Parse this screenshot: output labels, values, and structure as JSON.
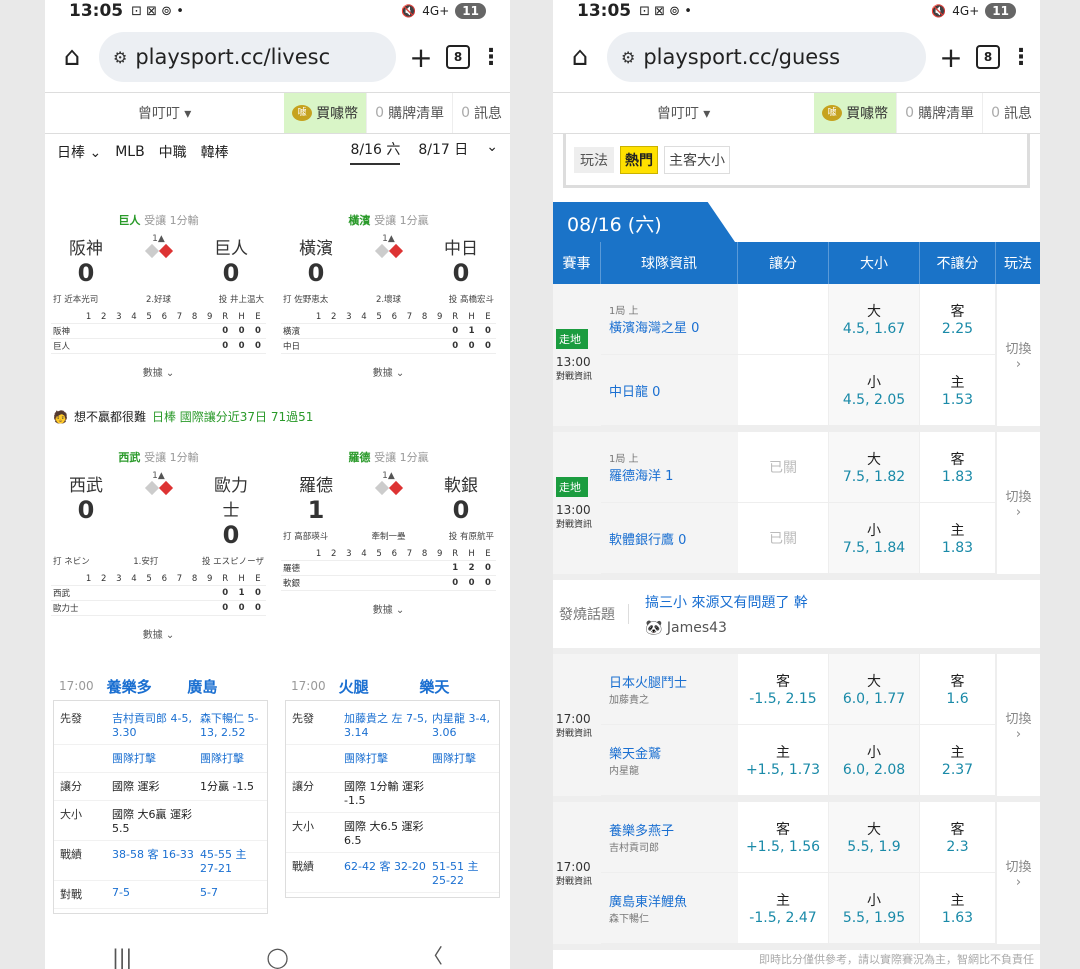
{
  "left": {
    "time": "13:05",
    "status_icons": "⊡ ⊠ ⊚ •",
    "signal": "4G+",
    "battery": "11",
    "url": "playsport.cc/livesc",
    "tab_count": "8",
    "user": "曾叮叮 ▾",
    "buy": "買噱幣",
    "cart_count": "0",
    "cart": "購牌清單",
    "msg_count": "0",
    "msg": "訊息",
    "leagues": [
      "日棒 ⌄",
      "MLB",
      "中職",
      "韓棒"
    ],
    "date1": "8/16 六",
    "date2": "8/17 日",
    "games": [
      {
        "top_team": "巨人",
        "top_sub": "受讓 1分輸",
        "home": "阪神",
        "away": "巨人",
        "hs": "0",
        "as": "0",
        "inning": "1▲",
        "b1": "打 近本光司",
        "b2": "2.好球",
        "b3": "投 井上温大",
        "rows": [
          [
            "阪神",
            "0",
            "0",
            "0"
          ],
          [
            "巨人",
            "0",
            "0",
            "0"
          ]
        ],
        "more": "數據 ⌄"
      },
      {
        "top_team": "橫濱",
        "top_sub": "受讓 1分贏",
        "home": "橫濱",
        "away": "中日",
        "hs": "0",
        "as": "0",
        "inning": "1▲",
        "b1": "打 佐野恵太",
        "b2": "2.壞球",
        "b3": "投 髙橋宏斗",
        "rows": [
          [
            "橫濱",
            "0",
            "1",
            "0"
          ],
          [
            "中日",
            "0",
            "0",
            "0"
          ]
        ],
        "more": "數據 ⌄"
      },
      {
        "top_team": "西武",
        "top_sub": "受讓 1分輸",
        "home": "西武",
        "away": "歐力士",
        "hs": "0",
        "as": "0",
        "inning": "1▲",
        "b1": "打 ネビン",
        "b2": "1.安打",
        "b3": "投 エスピノーザ",
        "rows": [
          [
            "西武",
            "0",
            "1",
            "0"
          ],
          [
            "歐力士",
            "0",
            "0",
            "0"
          ]
        ],
        "more": "數據 ⌄"
      },
      {
        "top_team": "羅德",
        "top_sub": "受讓 1分贏",
        "home": "羅德",
        "away": "軟銀",
        "hs": "1",
        "as": "0",
        "inning": "1▲",
        "b1": "打 高部瑛斗",
        "b2": "牽制一壘",
        "b3": "投 有原航平",
        "rows": [
          [
            "羅德",
            "1",
            "2",
            "0"
          ],
          [
            "軟銀",
            "0",
            "0",
            "0"
          ]
        ],
        "more": "數據 ⌄"
      }
    ],
    "inning_header": [
      "1",
      "2",
      "3",
      "4",
      "5",
      "6",
      "7",
      "8",
      "9",
      "R",
      "H",
      "E"
    ],
    "note_user": "想不贏都很難",
    "note_text": "日棒 國際讓分近37日 71過51",
    "cards": [
      {
        "time": "17:00",
        "t1": "養樂多",
        "t2": "廣島",
        "rows": [
          [
            "先發",
            "吉村貢司郎 4-5, 3.30",
            "森下暢仁 5-13, 2.52"
          ],
          [
            "",
            "團隊打擊",
            "團隊打擊"
          ],
          [
            "讓分",
            "國際 運彩",
            "1分贏 -1.5"
          ],
          [
            "大小",
            "國際 大6贏 運彩 5.5",
            ""
          ],
          [
            "戰績",
            "38-58 客 16-33",
            "45-55 主 27-21"
          ],
          [
            "對戰",
            "7-5",
            "5-7"
          ]
        ]
      },
      {
        "time": "17:00",
        "t1": "火腿",
        "t2": "樂天",
        "rows": [
          [
            "先發",
            "加藤貴之 左 7-5, 3.14",
            "内星龍 3-4, 3.06"
          ],
          [
            "",
            "團隊打擊",
            "團隊打擊"
          ],
          [
            "讓分",
            "國際 1分輸 運彩 -1.5",
            ""
          ],
          [
            "大小",
            "國際 大6.5 運彩 6.5",
            ""
          ],
          [
            "戰績",
            "62-42 客 32-20",
            "51-51 主 25-22"
          ]
        ]
      }
    ]
  },
  "right": {
    "time": "13:05",
    "status_icons": "⊡ ⊠ ⊚ •",
    "signal": "4G+",
    "battery": "11",
    "url": "playsport.cc/guess",
    "tab_count": "8",
    "user": "曾叮叮 ▾",
    "buy": "買噱幣",
    "cart_count": "0",
    "cart": "購牌清單",
    "msg_count": "0",
    "msg": "訊息",
    "play_label": "玩法",
    "hot": "熱門",
    "home_over": "主客大小",
    "date": "08/16 (六)",
    "headers": [
      "賽事",
      "球隊資訊",
      "讓分",
      "大小",
      "不讓分",
      "玩法"
    ],
    "groups": [
      {
        "status": "走地",
        "time": "13:00",
        "vs": "對戰資訊",
        "inning": "1局 上",
        "rows": [
          {
            "team": "橫濱海灣之星 0",
            "sub": "",
            "spread": "",
            "total_l": "大",
            "total_v": "4.5, 1.67",
            "ml_l": "客",
            "ml_v": "2.25"
          },
          {
            "team": "中日龍 0",
            "sub": "",
            "spread": "",
            "total_l": "小",
            "total_v": "4.5, 2.05",
            "ml_l": "主",
            "ml_v": "1.53"
          }
        ],
        "switch": "切換"
      },
      {
        "status": "走地",
        "time": "13:00",
        "vs": "對戰資訊",
        "inning": "1局 上",
        "rows": [
          {
            "team": "羅德海洋 1",
            "sub": "",
            "spread": "已關",
            "total_l": "大",
            "total_v": "7.5, 1.82",
            "ml_l": "客",
            "ml_v": "1.83"
          },
          {
            "team": "軟體銀行鷹 0",
            "sub": "",
            "spread": "已關",
            "total_l": "小",
            "total_v": "7.5, 1.84",
            "ml_l": "主",
            "ml_v": "1.83"
          }
        ],
        "switch": "切換"
      }
    ],
    "hotpost_label": "發燒話題",
    "hotpost_title": "搞三小 來源又有問題了 幹",
    "hotpost_author": "James43",
    "groups2": [
      {
        "time": "17:00",
        "vs": "對戰資訊",
        "rows": [
          {
            "team": "日本火腿鬥士",
            "sub": "加藤貴之",
            "spread_l": "客",
            "spread_v": "-1.5, 2.15",
            "total_l": "大",
            "total_v": "6.0, 1.77",
            "ml_l": "客",
            "ml_v": "1.6"
          },
          {
            "team": "樂天金鷲",
            "sub": "内星龍",
            "spread_l": "主",
            "spread_v": "+1.5, 1.73",
            "total_l": "小",
            "total_v": "6.0, 2.08",
            "ml_l": "主",
            "ml_v": "2.37"
          }
        ],
        "switch": "切換"
      },
      {
        "time": "17:00",
        "vs": "對戰資訊",
        "rows": [
          {
            "team": "養樂多燕子",
            "sub": "吉村貢司郎",
            "spread_l": "客",
            "spread_v": "+1.5, 1.56",
            "total_l": "大",
            "total_v": "5.5, 1.9",
            "ml_l": "客",
            "ml_v": "2.3"
          },
          {
            "team": "廣島東洋鯉魚",
            "sub": "森下暢仁",
            "spread_l": "主",
            "spread_v": "-1.5, 2.47",
            "total_l": "小",
            "total_v": "5.5, 1.95",
            "ml_l": "主",
            "ml_v": "1.63"
          }
        ],
        "switch": "切換"
      }
    ],
    "footer": "即時比分僅供參考，請以實際賽況為主，智網比不負責任"
  },
  "nav": [
    "|||",
    "◯",
    "〈"
  ]
}
